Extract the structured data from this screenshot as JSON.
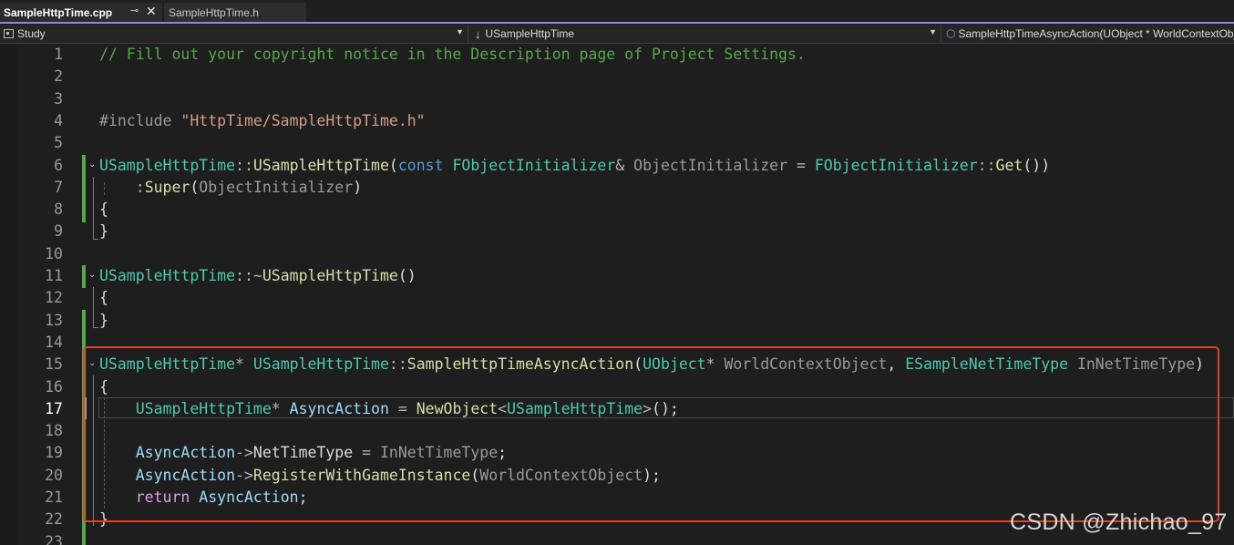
{
  "tabs": [
    {
      "label": "SampleHttpTime.cpp",
      "pin": "⊸",
      "close": "✕"
    },
    {
      "label": "SampleHttpTime.h"
    }
  ],
  "navbar": {
    "project": "Study",
    "class": "USampleHttpTime",
    "member": "SampleHttpTimeAsyncAction(UObject * WorldContextObject, ESampleNetTimeType InNetTimeType)"
  },
  "icons": {
    "project": "project-icon",
    "class": "down-arrow-icon",
    "member": "method-cube-icon"
  },
  "current_line": 17,
  "lines": [
    {
      "n": "1",
      "tokens": [
        {
          "c": "cm",
          "t": "// Fill out your copyright notice in the Description page of Project Settings."
        }
      ]
    },
    {
      "n": "2",
      "tokens": []
    },
    {
      "n": "3",
      "tokens": []
    },
    {
      "n": "4",
      "tokens": [
        {
          "c": "pp",
          "t": "#include "
        },
        {
          "c": "st",
          "t": "\"HttpTime/SampleHttpTime.h\""
        }
      ]
    },
    {
      "n": "5",
      "tokens": []
    },
    {
      "n": "6",
      "tokens": [
        {
          "c": "ty",
          "t": "USampleHttpTime"
        },
        {
          "c": "op",
          "t": "::"
        },
        {
          "c": "fn",
          "t": "USampleHttpTime"
        },
        {
          "c": "pl",
          "t": "("
        },
        {
          "c": "kw",
          "t": "const "
        },
        {
          "c": "ty",
          "t": "FObjectInitializer"
        },
        {
          "c": "op",
          "t": "& "
        },
        {
          "c": "pa",
          "t": "ObjectInitializer"
        },
        {
          "c": "op",
          "t": " = "
        },
        {
          "c": "ty",
          "t": "FObjectInitializer"
        },
        {
          "c": "op",
          "t": "::"
        },
        {
          "c": "fn",
          "t": "Get"
        },
        {
          "c": "pl",
          "t": "())"
        }
      ]
    },
    {
      "n": "7",
      "tokens": [
        {
          "c": "pl",
          "t": "    "
        },
        {
          "c": "op",
          "t": ":"
        },
        {
          "c": "fn",
          "t": "Super"
        },
        {
          "c": "pl",
          "t": "("
        },
        {
          "c": "pa",
          "t": "ObjectInitializer"
        },
        {
          "c": "pl",
          "t": ")"
        }
      ]
    },
    {
      "n": "8",
      "tokens": [
        {
          "c": "pl",
          "t": "{"
        }
      ]
    },
    {
      "n": "9",
      "tokens": [
        {
          "c": "pl",
          "t": "}"
        }
      ]
    },
    {
      "n": "10",
      "tokens": []
    },
    {
      "n": "11",
      "tokens": [
        {
          "c": "ty",
          "t": "USampleHttpTime"
        },
        {
          "c": "op",
          "t": "::~"
        },
        {
          "c": "fn",
          "t": "USampleHttpTime"
        },
        {
          "c": "pl",
          "t": "()"
        }
      ]
    },
    {
      "n": "12",
      "tokens": [
        {
          "c": "pl",
          "t": "{"
        }
      ]
    },
    {
      "n": "13",
      "tokens": [
        {
          "c": "pl",
          "t": "}"
        }
      ]
    },
    {
      "n": "14",
      "tokens": []
    },
    {
      "n": "15",
      "tokens": [
        {
          "c": "ty",
          "t": "USampleHttpTime"
        },
        {
          "c": "op",
          "t": "* "
        },
        {
          "c": "ty",
          "t": "USampleHttpTime"
        },
        {
          "c": "op",
          "t": "::"
        },
        {
          "c": "fn",
          "t": "SampleHttpTimeAsyncAction"
        },
        {
          "c": "pl",
          "t": "("
        },
        {
          "c": "ty",
          "t": "UObject"
        },
        {
          "c": "op",
          "t": "* "
        },
        {
          "c": "pa",
          "t": "WorldContextObject"
        },
        {
          "c": "pl",
          "t": ", "
        },
        {
          "c": "ty",
          "t": "ESampleNetTimeType "
        },
        {
          "c": "pa",
          "t": "InNetTimeType"
        },
        {
          "c": "pl",
          "t": ")"
        }
      ]
    },
    {
      "n": "16",
      "tokens": [
        {
          "c": "pl",
          "t": "{"
        }
      ]
    },
    {
      "n": "17",
      "tokens": [
        {
          "c": "pl",
          "t": "    "
        },
        {
          "c": "ty",
          "t": "USampleHttpTime"
        },
        {
          "c": "op",
          "t": "* "
        },
        {
          "c": "va",
          "t": "AsyncAction"
        },
        {
          "c": "op",
          "t": " = "
        },
        {
          "c": "fn",
          "t": "NewObject"
        },
        {
          "c": "op",
          "t": "<"
        },
        {
          "c": "ty",
          "t": "USampleHttpTime"
        },
        {
          "c": "op",
          "t": ">"
        },
        {
          "c": "pl",
          "t": "();"
        }
      ]
    },
    {
      "n": "18",
      "tokens": []
    },
    {
      "n": "19",
      "tokens": [
        {
          "c": "pl",
          "t": "    "
        },
        {
          "c": "va",
          "t": "AsyncAction"
        },
        {
          "c": "op",
          "t": "->"
        },
        {
          "c": "pl",
          "t": "NetTimeType"
        },
        {
          "c": "op",
          "t": " = "
        },
        {
          "c": "pa",
          "t": "InNetTimeType"
        },
        {
          "c": "pl",
          "t": ";"
        }
      ]
    },
    {
      "n": "20",
      "tokens": [
        {
          "c": "pl",
          "t": "    "
        },
        {
          "c": "va",
          "t": "AsyncAction"
        },
        {
          "c": "op",
          "t": "->"
        },
        {
          "c": "fn",
          "t": "RegisterWithGameInstance"
        },
        {
          "c": "pl",
          "t": "("
        },
        {
          "c": "pa",
          "t": "WorldContextObject"
        },
        {
          "c": "pl",
          "t": ");"
        }
      ]
    },
    {
      "n": "21",
      "tokens": [
        {
          "c": "pl",
          "t": "    "
        },
        {
          "c": "kw2",
          "t": "return "
        },
        {
          "c": "va",
          "t": "AsyncAction"
        },
        {
          "c": "pl",
          "t": ";"
        }
      ]
    },
    {
      "n": "22",
      "tokens": [
        {
          "c": "pl",
          "t": "}"
        }
      ]
    },
    {
      "n": "23",
      "tokens": []
    }
  ],
  "watermark": "CSDN @Zhichao_97"
}
